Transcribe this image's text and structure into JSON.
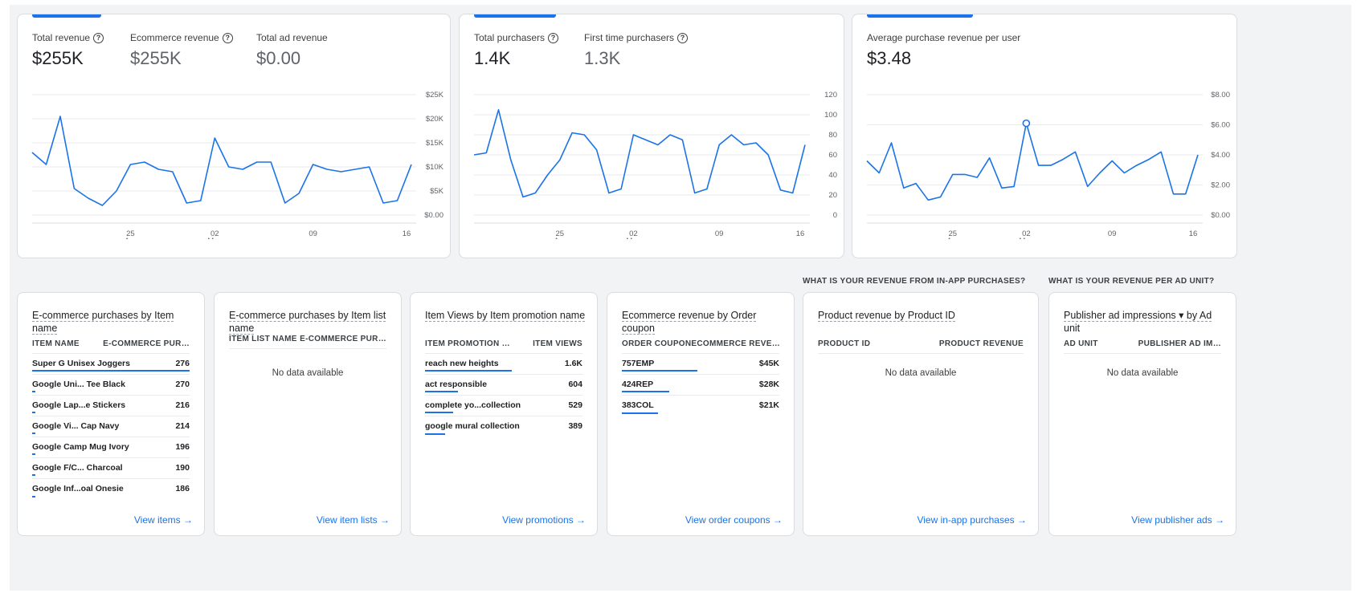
{
  "colors": {
    "accent": "#1a73e8",
    "text": "#202124",
    "muted": "#5f6368",
    "grid": "#e8eaed"
  },
  "x_ticks": [
    {
      "day": "25",
      "month": "Apr"
    },
    {
      "day": "02",
      "month": "May"
    },
    {
      "day": "09",
      "month": ""
    },
    {
      "day": "16",
      "month": ""
    }
  ],
  "revenue_card": {
    "metrics": [
      {
        "label": "Total revenue",
        "value": "$255K",
        "help": true
      },
      {
        "label": "Ecommerce revenue",
        "value": "$255K",
        "help": true
      },
      {
        "label": "Total ad revenue",
        "value": "$0.00",
        "help": false
      }
    ]
  },
  "purchasers_card": {
    "metrics": [
      {
        "label": "Total purchasers",
        "value": "1.4K",
        "help": true
      },
      {
        "label": "First time purchasers",
        "value": "1.3K",
        "help": true
      }
    ]
  },
  "arppu_card": {
    "metrics": [
      {
        "label": "Average purchase revenue per user",
        "value": "$3.48",
        "help": false
      }
    ]
  },
  "chart_data": [
    {
      "type": "line",
      "title": "Total revenue",
      "y_tick_labels": [
        "$25K",
        "$20K",
        "$15K",
        "$10K",
        "$5K",
        "$0.00"
      ],
      "ylim": [
        0,
        25000
      ],
      "x_range": [
        "Apr 18",
        "May 17"
      ],
      "series": [
        {
          "name": "Total revenue",
          "values": [
            13000,
            10500,
            20500,
            5500,
            3500,
            2000,
            5000,
            10500,
            11000,
            9500,
            9000,
            2500,
            3000,
            16000,
            10000,
            9500,
            11000,
            11000,
            2500,
            4500,
            10500,
            9500,
            9000,
            9500,
            10000,
            2500,
            3000,
            10500
          ]
        }
      ],
      "grid": true
    },
    {
      "type": "line",
      "title": "Total purchasers",
      "y_tick_labels": [
        "120",
        "100",
        "80",
        "60",
        "40",
        "20",
        "0"
      ],
      "ylim": [
        0,
        120
      ],
      "x_range": [
        "Apr 18",
        "May 17"
      ],
      "series": [
        {
          "name": "Total purchasers",
          "values": [
            60,
            62,
            105,
            55,
            18,
            22,
            40,
            55,
            82,
            80,
            65,
            22,
            26,
            80,
            75,
            70,
            80,
            75,
            22,
            26,
            70,
            80,
            70,
            72,
            60,
            25,
            22,
            70
          ]
        }
      ],
      "grid": true
    },
    {
      "type": "line",
      "title": "Average purchase revenue per user",
      "y_tick_labels": [
        "$8.00",
        "$6.00",
        "$4.00",
        "$2.00",
        "$0.00"
      ],
      "ylim": [
        0,
        8
      ],
      "x_range": [
        "Apr 18",
        "May 17"
      ],
      "series": [
        {
          "name": "Average purchase revenue per user",
          "values": [
            3.6,
            2.8,
            4.8,
            1.8,
            2.1,
            1.0,
            1.2,
            2.7,
            2.7,
            2.5,
            3.8,
            1.8,
            1.9,
            6.1,
            3.3,
            3.3,
            3.7,
            4.2,
            1.9,
            2.8,
            3.6,
            2.8,
            3.3,
            3.7,
            4.2,
            1.4,
            1.4,
            4.0
          ]
        }
      ],
      "highlight_index": 13,
      "grid": true
    }
  ],
  "section_headings": {
    "in_app": "WHAT IS YOUR REVENUE FROM IN-APP PURCHASES?",
    "ad_unit": "WHAT IS YOUR REVENUE PER AD UNIT?"
  },
  "cards": {
    "item_name": {
      "title_a": "E-commerce purchases by Item name",
      "title_b": "",
      "col1": "ITEM NAME",
      "col2": "E-COMMERCE PUR…",
      "rows": [
        {
          "name": "Super G Unisex Joggers",
          "value": "276",
          "share": 1.0
        },
        {
          "name": "Google Uni... Tee Black",
          "value": "270",
          "share": 0.02
        },
        {
          "name": "Google Lap...e Stickers",
          "value": "216",
          "share": 0.02
        },
        {
          "name": "Google Vi... Cap Navy",
          "value": "214",
          "share": 0.02
        },
        {
          "name": "Google Camp Mug Ivory",
          "value": "196",
          "share": 0.02
        },
        {
          "name": "Google F/C... Charcoal",
          "value": "190",
          "share": 0.02
        },
        {
          "name": "Google Inf...oal Onesie",
          "value": "186",
          "share": 0.02
        }
      ],
      "link": "View items →"
    },
    "item_list": {
      "title_a": "E-commerce purchases by Item list",
      "title_b": "name",
      "col1": "ITEM LIST NAME",
      "col2": "E-COMMERCE PUR…",
      "no_data": "No data available",
      "link": "View item lists →"
    },
    "promotion": {
      "title_a": "Item Views by Item promotion name",
      "title_b": "",
      "col1": "ITEM PROMOTION …",
      "col2": "ITEM VIEWS",
      "rows": [
        {
          "name": "reach new heights",
          "value": "1.6K",
          "share": 0.55
        },
        {
          "name": "act responsible",
          "value": "604",
          "share": 0.21
        },
        {
          "name": "complete yo...collection",
          "value": "529",
          "share": 0.18
        },
        {
          "name": "google mural collection",
          "value": "389",
          "share": 0.13
        }
      ],
      "link": "View promotions →"
    },
    "coupon": {
      "title_a": "Ecommerce revenue by Order",
      "title_b": "coupon",
      "col1": "ORDER COUPON",
      "col2": "ECOMMERCE REVE…",
      "rows": [
        {
          "name": "757EMP",
          "value": "$45K",
          "share": 0.48
        },
        {
          "name": "424REP",
          "value": "$28K",
          "share": 0.3
        },
        {
          "name": "383COL",
          "value": "$21K",
          "share": 0.23
        }
      ],
      "link": "View order coupons →"
    },
    "product": {
      "title_a": "Product revenue by Product ID",
      "title_b": "",
      "col1": "PRODUCT ID",
      "col2": "PRODUCT REVENUE",
      "no_data": "No data available",
      "link": "View in-app purchases →"
    },
    "publisher": {
      "title_a": "Publisher ad impressions ▾ by Ad",
      "title_b": "unit",
      "col1": "AD UNIT",
      "col2": "PUBLISHER AD IM…",
      "no_data": "No data available",
      "link": "View publisher ads →"
    }
  }
}
